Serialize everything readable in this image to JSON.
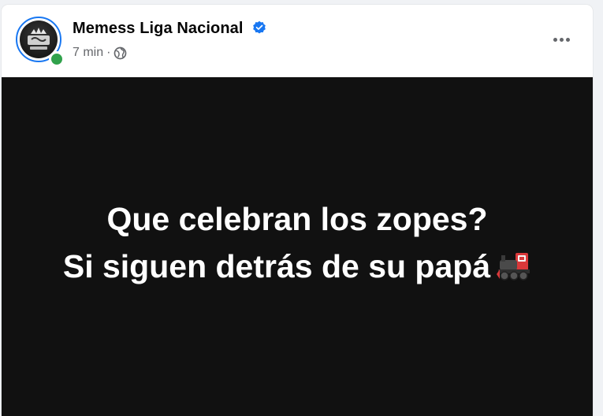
{
  "post": {
    "page_name": "Memess Liga Nacional",
    "time": "7 min",
    "separator": "·",
    "audience_icon": "globe-icon",
    "verified_icon": "verified-badge-icon",
    "more_icon": "more-options-icon",
    "status": "online",
    "colors": {
      "verified": "#1877f2",
      "online": "#31a24c",
      "media_bg": "#111111"
    }
  },
  "media": {
    "line1": "Que celebran los zopes?",
    "line2": "Si siguen detrás de su papá",
    "emoji_icon": "locomotive-icon"
  }
}
